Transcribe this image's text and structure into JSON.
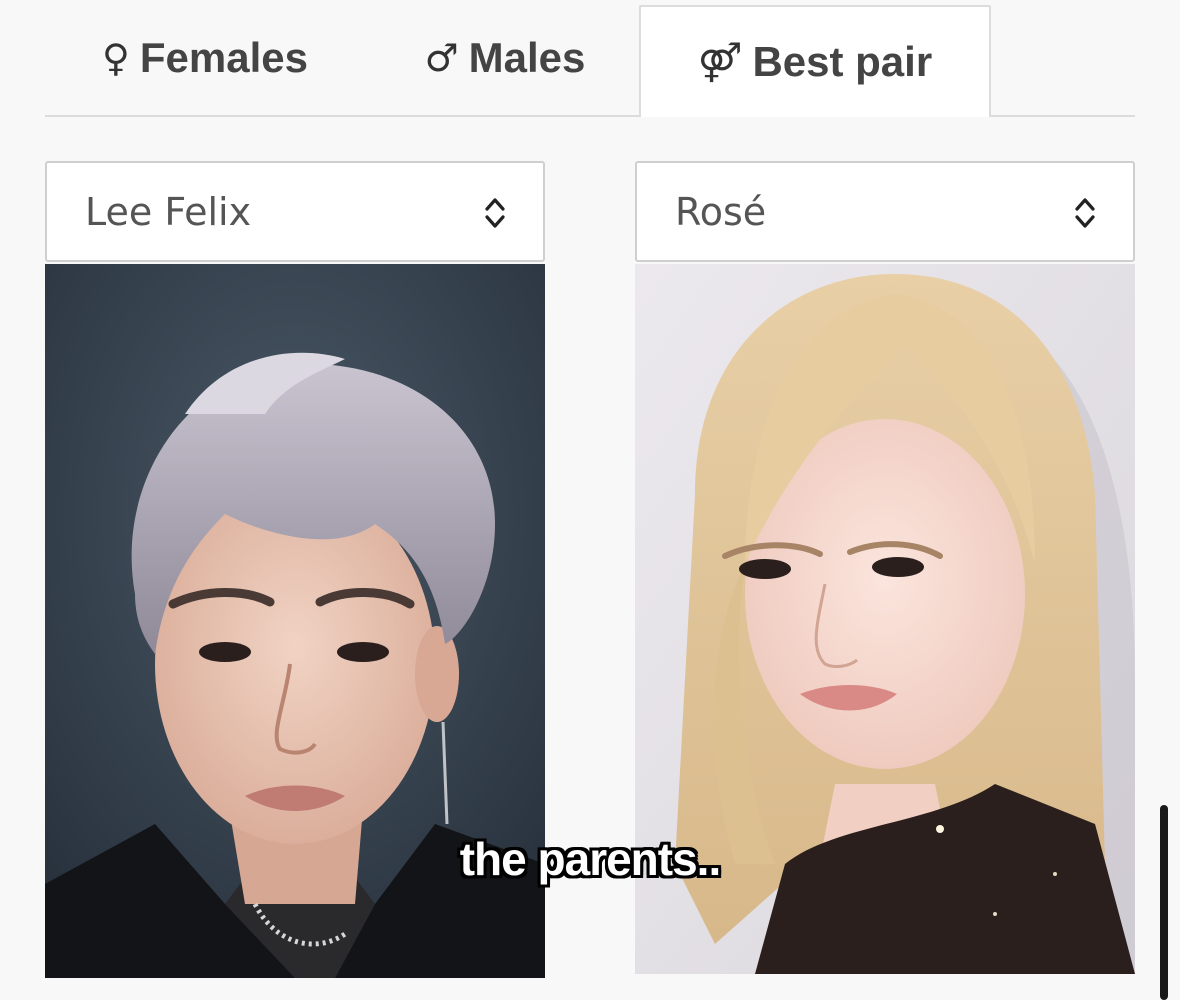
{
  "tabs": [
    {
      "icon": "female-symbol-icon",
      "glyph": "♀",
      "label": "Females"
    },
    {
      "icon": "male-symbol-icon",
      "glyph": "♂",
      "label": "Males"
    },
    {
      "icon": "couple-symbol-icon",
      "glyph": "⚤",
      "label": "Best pair",
      "active": true
    }
  ],
  "selects": {
    "left": {
      "value": "Lee Felix"
    },
    "right": {
      "value": "Rosé"
    }
  },
  "caption": "the parents..",
  "colors": {
    "page_background": "#f8f8f8",
    "tab_text": "#444444",
    "border": "#dcdcdc",
    "scrollbar": "#1a1a1a"
  }
}
